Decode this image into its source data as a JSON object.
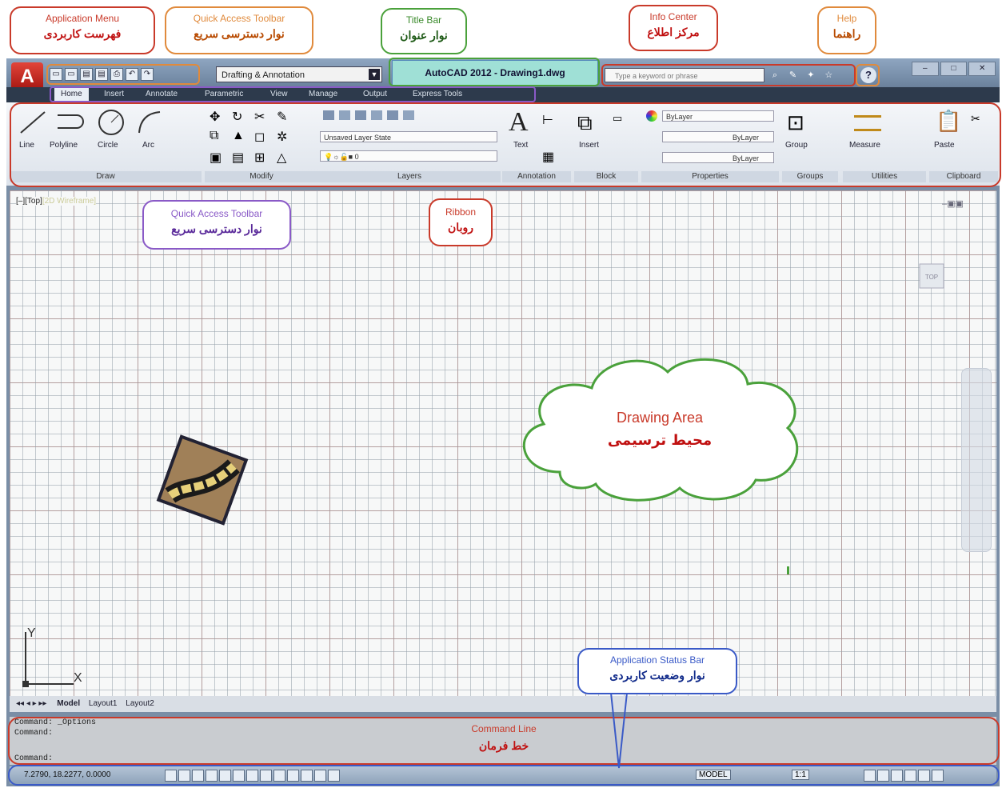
{
  "app": {
    "title": "AutoCAD 2012 - Drawing1.dwg",
    "app_button": "A",
    "workspace": "Drafting & Annotation",
    "search_placeholder": "Type a keyword or phrase",
    "help": "?"
  },
  "ribbon_tabs": [
    "Home",
    "Insert",
    "Annotate",
    "Parametric",
    "View",
    "Manage",
    "Output",
    "Express Tools"
  ],
  "ribbon": {
    "draw": {
      "line": "Line",
      "polyline": "Polyline",
      "circle": "Circle",
      "arc": "Arc",
      "label": "Draw"
    },
    "modify": {
      "label": "Modify"
    },
    "layers": {
      "layer_state": "Unsaved Layer State",
      "layer": "0",
      "label": "Layers"
    },
    "annotation": {
      "text": "Text",
      "label": "Annotation"
    },
    "block": {
      "insert": "Insert",
      "label": "Block"
    },
    "properties": {
      "color": "ByLayer",
      "linetype": "ByLayer",
      "lineweight": "ByLayer",
      "label": "Properties"
    },
    "groups": {
      "group": "Group",
      "label": "Groups"
    },
    "utilities": {
      "measure": "Measure",
      "label": "Utilities"
    },
    "clipboard": {
      "paste": "Paste",
      "label": "Clipboard"
    }
  },
  "viewport_label": "[–][Top]",
  "viewport_style": "[2D Wireframe]",
  "viewcube": "TOP",
  "ucs": {
    "x": "X",
    "y": "Y"
  },
  "layout_tabs": [
    "Model",
    "Layout1",
    "Layout2"
  ],
  "command_lines": [
    "Command:  _Options",
    "Command:",
    "Command:"
  ],
  "status": {
    "coords": "7.2790, 18.2277, 0.0000",
    "model": "MODEL",
    "scale": "1:1"
  },
  "callouts": {
    "app_menu": {
      "en": "Application Menu",
      "fa": "فهرست کاربردی"
    },
    "qat_top": {
      "en": "Quick Access Toolbar",
      "fa": "نوار دسترسی سریع"
    },
    "title_bar": {
      "en": "Title Bar",
      "fa": "نوار عنوان"
    },
    "info_center": {
      "en": "Info Center",
      "fa": "مرکز اطلاع"
    },
    "help": {
      "en": "Help",
      "fa": "راهنما"
    },
    "qat_bottom": {
      "en": "Quick Access Toolbar",
      "fa": "نوار دسترسی سریع"
    },
    "ribbon": {
      "en": "Ribbon",
      "fa": "روبان"
    },
    "drawing_area": {
      "en": "Drawing Area",
      "fa": "محیط ترسیمی"
    },
    "status_bar": {
      "en": "Application Status Bar",
      "fa": "نوار وضعیت کاربردی"
    },
    "command_line": {
      "en": "Command Line",
      "fa": "خط فرمان"
    }
  },
  "colors": {
    "red": "#c93a2a",
    "orange": "#e08a3c",
    "green": "#4aa13b",
    "purple": "#8a5ac7",
    "blue": "#3a5ac7"
  }
}
